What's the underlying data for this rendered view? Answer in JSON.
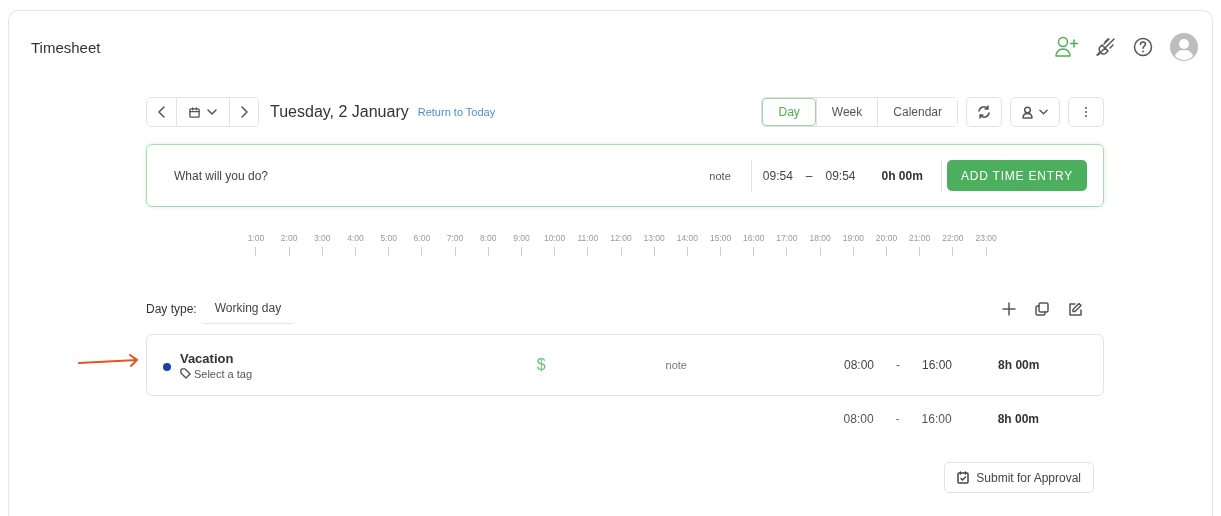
{
  "title": "Timesheet",
  "date_nav": {
    "date": "Tuesday, 2 January",
    "link": "Return to Today"
  },
  "view_tabs": [
    {
      "label": "Day",
      "selected": true
    },
    {
      "label": "Week",
      "selected": false
    },
    {
      "label": "Calendar",
      "selected": false
    }
  ],
  "new_entry": {
    "placeholder": "What will you do?",
    "note_placeholder": "note",
    "start": "09:54",
    "separator": "–",
    "end": "09:54",
    "duration": "0h 00m",
    "button": "ADD TIME ENTRY"
  },
  "timeline": [
    "1:00",
    "2:00",
    "3:00",
    "4:00",
    "5:00",
    "6:00",
    "7:00",
    "8:00",
    "9:00",
    "10:00",
    "11:00",
    "12:00",
    "13:00",
    "14:00",
    "15:00",
    "16:00",
    "17:00",
    "18:00",
    "19:00",
    "20:00",
    "21:00",
    "22:00",
    "23:00"
  ],
  "day_type": {
    "label": "Day type:",
    "value": "Working day"
  },
  "entries": [
    {
      "project": "Vacation",
      "color": "#1a3fb0",
      "tag": "Select a tag",
      "billable": true,
      "billable_symbol": "$",
      "note_placeholder": "note",
      "start": "08:00",
      "separator": "-",
      "end": "16:00",
      "duration": "8h 00m",
      "highlighted": true
    }
  ],
  "totals": {
    "start": "08:00",
    "separator": "-",
    "end": "16:00",
    "duration": "8h 00m"
  },
  "submit_button": "Submit for Approval"
}
